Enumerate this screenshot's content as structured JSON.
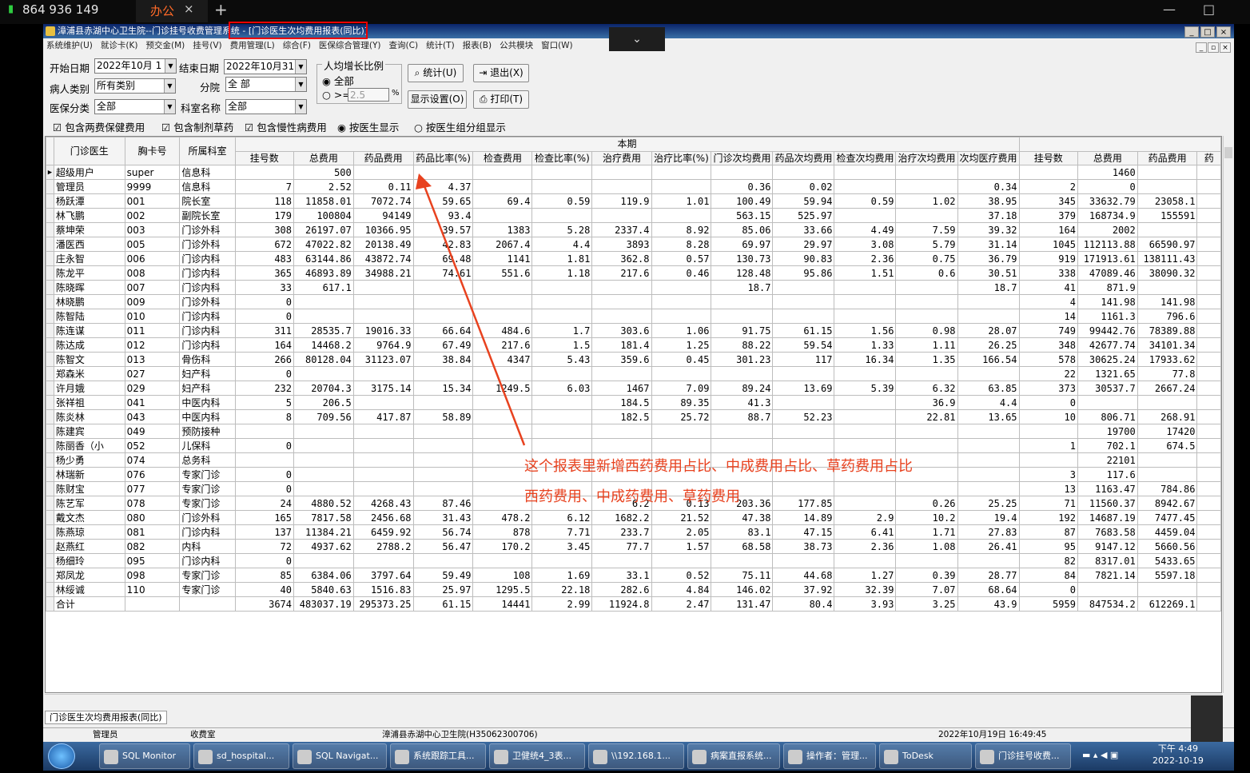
{
  "outer": {
    "phone": "864 936 149",
    "tab_label": "办公",
    "tab_close": "×",
    "new_tab": "+",
    "min": "—",
    "max": "□",
    "chevron": "⌄"
  },
  "window": {
    "title": "漳浦县赤湖中心卫生院--门诊挂号收费管理系统 - [门诊医生次均费用报表(同比)]",
    "buttons": [
      "_",
      "□",
      "×"
    ],
    "mdi_buttons": [
      "_",
      "▫",
      "×"
    ]
  },
  "menu": [
    "系统维护(U)",
    "就诊卡(K)",
    "预交金(M)",
    "挂号(V)",
    "费用管理(L)",
    "综合(F)",
    "医保综合管理(Y)",
    "查询(C)",
    "统计(T)",
    "报表(B)",
    "公共模块",
    "窗口(W)"
  ],
  "filters": {
    "start_date_label": "开始日期",
    "start_date": "2022年10月 1",
    "end_date_label": "结束日期",
    "end_date": "2022年10月31",
    "patient_type_label": "病人类别",
    "patient_type": "所有类别",
    "branch_label": "分院",
    "branch": "全 部",
    "insurance_label": "医保分类",
    "insurance": "全部",
    "dept_label": "科室名称",
    "dept": "全部"
  },
  "growth": {
    "title": "人均增长比例",
    "opt_all": "全部",
    "opt_ge": ">=",
    "ge_value": "2.5",
    "pct": "%"
  },
  "buttons": {
    "stat": "统计(U)",
    "exit": "退出(X)",
    "display": "显示设置(O)",
    "print": "打印(T)"
  },
  "checks": {
    "c1": "包含两费保健费用",
    "c2": "包含制剂草药",
    "c3": "包含慢性病费用",
    "r1": "按医生显示",
    "r2": "按医生组分组显示"
  },
  "grid": {
    "group_header": "本期",
    "headers": [
      "门诊医生",
      "胸卡号",
      "所属科室",
      "挂号数",
      "总费用",
      "药品费用",
      "药品比率(%)",
      "检查费用",
      "检查比率(%)",
      "治疗费用",
      "治疗比率(%)",
      "门诊次均费用",
      "药品次均费用",
      "检查次均费用",
      "治疗次均费用",
      "次均医疗费用",
      "挂号数",
      "总费用",
      "药品费用",
      "药"
    ],
    "rows": [
      [
        "超级用户",
        "super",
        "信息科",
        "",
        "500",
        "",
        "",
        "",
        "",
        "",
        "",
        "",
        "",
        "",
        "",
        "",
        "",
        "1460",
        ""
      ],
      [
        "管理员",
        "9999",
        "信息科",
        "7",
        "2.52",
        "0.11",
        "4.37",
        "",
        "",
        "",
        "",
        "0.36",
        "0.02",
        "",
        "",
        "0.34",
        "2",
        "0",
        ""
      ],
      [
        "杨跃潭",
        "001",
        "院长室",
        "118",
        "11858.01",
        "7072.74",
        "59.65",
        "69.4",
        "0.59",
        "119.9",
        "1.01",
        "100.49",
        "59.94",
        "0.59",
        "1.02",
        "38.95",
        "345",
        "33632.79",
        "23058.1"
      ],
      [
        "林飞鹏",
        "002",
        "副院长室",
        "179",
        "100804",
        "94149",
        "93.4",
        "",
        "",
        "",
        "",
        "563.15",
        "525.97",
        "",
        "",
        "37.18",
        "379",
        "168734.9",
        "155591"
      ],
      [
        "蔡坤荣",
        "003",
        "门诊外科",
        "308",
        "26197.07",
        "10366.95",
        "39.57",
        "1383",
        "5.28",
        "2337.4",
        "8.92",
        "85.06",
        "33.66",
        "4.49",
        "7.59",
        "39.32",
        "164",
        "2002",
        ""
      ],
      [
        "潘医西",
        "005",
        "门诊外科",
        "672",
        "47022.82",
        "20138.49",
        "42.83",
        "2067.4",
        "4.4",
        "3893",
        "8.28",
        "69.97",
        "29.97",
        "3.08",
        "5.79",
        "31.14",
        "1045",
        "112113.88",
        "66590.97"
      ],
      [
        "庄永智",
        "006",
        "门诊内科",
        "483",
        "63144.86",
        "43872.74",
        "69.48",
        "1141",
        "1.81",
        "362.8",
        "0.57",
        "130.73",
        "90.83",
        "2.36",
        "0.75",
        "36.79",
        "919",
        "171913.61",
        "138111.43"
      ],
      [
        "陈龙平",
        "008",
        "门诊内科",
        "365",
        "46893.89",
        "34988.21",
        "74.61",
        "551.6",
        "1.18",
        "217.6",
        "0.46",
        "128.48",
        "95.86",
        "1.51",
        "0.6",
        "30.51",
        "338",
        "47089.46",
        "38090.32"
      ],
      [
        "陈晓晖",
        "007",
        "门诊内科",
        "33",
        "617.1",
        "",
        "",
        "",
        "",
        "",
        "",
        "18.7",
        "",
        "",
        "",
        "18.7",
        "41",
        "871.9",
        ""
      ],
      [
        "林晓鹏",
        "009",
        "门诊外科",
        "0",
        "",
        "",
        "",
        "",
        "",
        "",
        "",
        "",
        "",
        "",
        "",
        "",
        "4",
        "141.98",
        "141.98"
      ],
      [
        "陈智陆",
        "010",
        "门诊内科",
        "0",
        "",
        "",
        "",
        "",
        "",
        "",
        "",
        "",
        "",
        "",
        "",
        "",
        "14",
        "1161.3",
        "796.6"
      ],
      [
        "陈连谋",
        "011",
        "门诊内科",
        "311",
        "28535.7",
        "19016.33",
        "66.64",
        "484.6",
        "1.7",
        "303.6",
        "1.06",
        "91.75",
        "61.15",
        "1.56",
        "0.98",
        "28.07",
        "749",
        "99442.76",
        "78389.88"
      ],
      [
        "陈达成",
        "012",
        "门诊内科",
        "164",
        "14468.2",
        "9764.9",
        "67.49",
        "217.6",
        "1.5",
        "181.4",
        "1.25",
        "88.22",
        "59.54",
        "1.33",
        "1.11",
        "26.25",
        "348",
        "42677.74",
        "34101.34"
      ],
      [
        "陈智文",
        "013",
        "骨伤科",
        "266",
        "80128.04",
        "31123.07",
        "38.84",
        "4347",
        "5.43",
        "359.6",
        "0.45",
        "301.23",
        "117",
        "16.34",
        "1.35",
        "166.54",
        "578",
        "30625.24",
        "17933.62"
      ],
      [
        "郑森米",
        "027",
        "妇产科",
        "0",
        "",
        "",
        "",
        "",
        "",
        "",
        "",
        "",
        "",
        "",
        "",
        "",
        "22",
        "1321.65",
        "77.8"
      ],
      [
        "许月娥",
        "029",
        "妇产科",
        "232",
        "20704.3",
        "3175.14",
        "15.34",
        "1249.5",
        "6.03",
        "1467",
        "7.09",
        "89.24",
        "13.69",
        "5.39",
        "6.32",
        "63.85",
        "373",
        "30537.7",
        "2667.24"
      ],
      [
        "张祥祖",
        "041",
        "中医内科",
        "5",
        "206.5",
        "",
        "",
        "",
        "",
        "184.5",
        "89.35",
        "41.3",
        "",
        "",
        "36.9",
        "4.4",
        "0",
        "",
        ""
      ],
      [
        "陈炎林",
        "043",
        "中医内科",
        "8",
        "709.56",
        "417.87",
        "58.89",
        "",
        "",
        "182.5",
        "25.72",
        "88.7",
        "52.23",
        "",
        "22.81",
        "13.65",
        "10",
        "806.71",
        "268.91"
      ],
      [
        "陈建宾",
        "049",
        "预防接种",
        "",
        "",
        "",
        "",
        "",
        "",
        "",
        "",
        "",
        "",
        "",
        "",
        "",
        "",
        "19700",
        "17420"
      ],
      [
        "陈丽香（小",
        "052",
        "儿保科",
        "0",
        "",
        "",
        "",
        "",
        "",
        "",
        "",
        "",
        "",
        "",
        "",
        "",
        "1",
        "702.1",
        "674.5"
      ],
      [
        "杨少勇",
        "074",
        "总务科",
        "",
        "",
        "",
        "",
        "",
        "",
        "",
        "",
        "",
        "",
        "",
        "",
        "",
        "",
        "22101",
        ""
      ],
      [
        "林瑞新",
        "076",
        "专家门诊",
        "0",
        "",
        "",
        "",
        "",
        "",
        "",
        "",
        "",
        "",
        "",
        "",
        "",
        "3",
        "117.6",
        ""
      ],
      [
        "陈财宝",
        "077",
        "专家门诊",
        "0",
        "",
        "",
        "",
        "",
        "",
        "",
        "",
        "",
        "",
        "",
        "",
        "",
        "13",
        "1163.47",
        "784.86"
      ],
      [
        "陈艺军",
        "078",
        "专家门诊",
        "24",
        "4880.52",
        "4268.43",
        "87.46",
        "",
        "",
        "6.2",
        "0.13",
        "203.36",
        "177.85",
        "",
        "0.26",
        "25.25",
        "71",
        "11560.37",
        "8942.67"
      ],
      [
        "戴文杰",
        "080",
        "门诊外科",
        "165",
        "7817.58",
        "2456.68",
        "31.43",
        "478.2",
        "6.12",
        "1682.2",
        "21.52",
        "47.38",
        "14.89",
        "2.9",
        "10.2",
        "19.4",
        "192",
        "14687.19",
        "7477.45"
      ],
      [
        "陈燕琼",
        "081",
        "门诊内科",
        "137",
        "11384.21",
        "6459.92",
        "56.74",
        "878",
        "7.71",
        "233.7",
        "2.05",
        "83.1",
        "47.15",
        "6.41",
        "1.71",
        "27.83",
        "87",
        "7683.58",
        "4459.04"
      ],
      [
        "赵燕红",
        "082",
        "内科",
        "72",
        "4937.62",
        "2788.2",
        "56.47",
        "170.2",
        "3.45",
        "77.7",
        "1.57",
        "68.58",
        "38.73",
        "2.36",
        "1.08",
        "26.41",
        "95",
        "9147.12",
        "5660.56"
      ],
      [
        "杨细玲",
        "095",
        "门诊内科",
        "0",
        "",
        "",
        "",
        "",
        "",
        "",
        "",
        "",
        "",
        "",
        "",
        "",
        "82",
        "8317.01",
        "5433.65"
      ],
      [
        "郑凤龙",
        "098",
        "专家门诊",
        "85",
        "6384.06",
        "3797.64",
        "59.49",
        "108",
        "1.69",
        "33.1",
        "0.52",
        "75.11",
        "44.68",
        "1.27",
        "0.39",
        "28.77",
        "84",
        "7821.14",
        "5597.18"
      ],
      [
        "林绥诚",
        "110",
        "专家门诊",
        "40",
        "5840.63",
        "1516.83",
        "25.97",
        "1295.5",
        "22.18",
        "282.6",
        "4.84",
        "146.02",
        "37.92",
        "32.39",
        "7.07",
        "68.64",
        "0",
        "",
        ""
      ],
      [
        "合计",
        "",
        "",
        "3674",
        "483037.19",
        "295373.25",
        "61.15",
        "14441",
        "2.99",
        "11924.8",
        "2.47",
        "131.47",
        "80.4",
        "3.93",
        "3.25",
        "43.9",
        "5959",
        "847534.2",
        "612269.1"
      ]
    ]
  },
  "annotation": {
    "line1": "这个报表里新增西药费用占比、中成费用占比、草药费用占比",
    "line2": "西药费用、中成药费用、草药费用"
  },
  "tab": "门诊医生次均费用报表(同比)",
  "status": {
    "user": "管理员",
    "room": "收费室",
    "hospital": "漳浦县赤湖中心卫生院(H35062300706)",
    "datetime": "2022年10月19日 16:49:45"
  },
  "taskbar": {
    "items": [
      "SQL Monitor",
      "sd_hospital...",
      "SQL Navigat...",
      "系统跟踪工具...",
      "卫健统4_3表...",
      "\\\\192.168.1...",
      "病案直报系统...",
      "操作者：管理...",
      "ToDesk",
      "门诊挂号收费..."
    ],
    "time": "下午 4:49",
    "date": "2022-10-19"
  },
  "colors": {
    "annotation": "#e8421f",
    "highlight": "#e00000",
    "title_bar": "#0a246a"
  }
}
